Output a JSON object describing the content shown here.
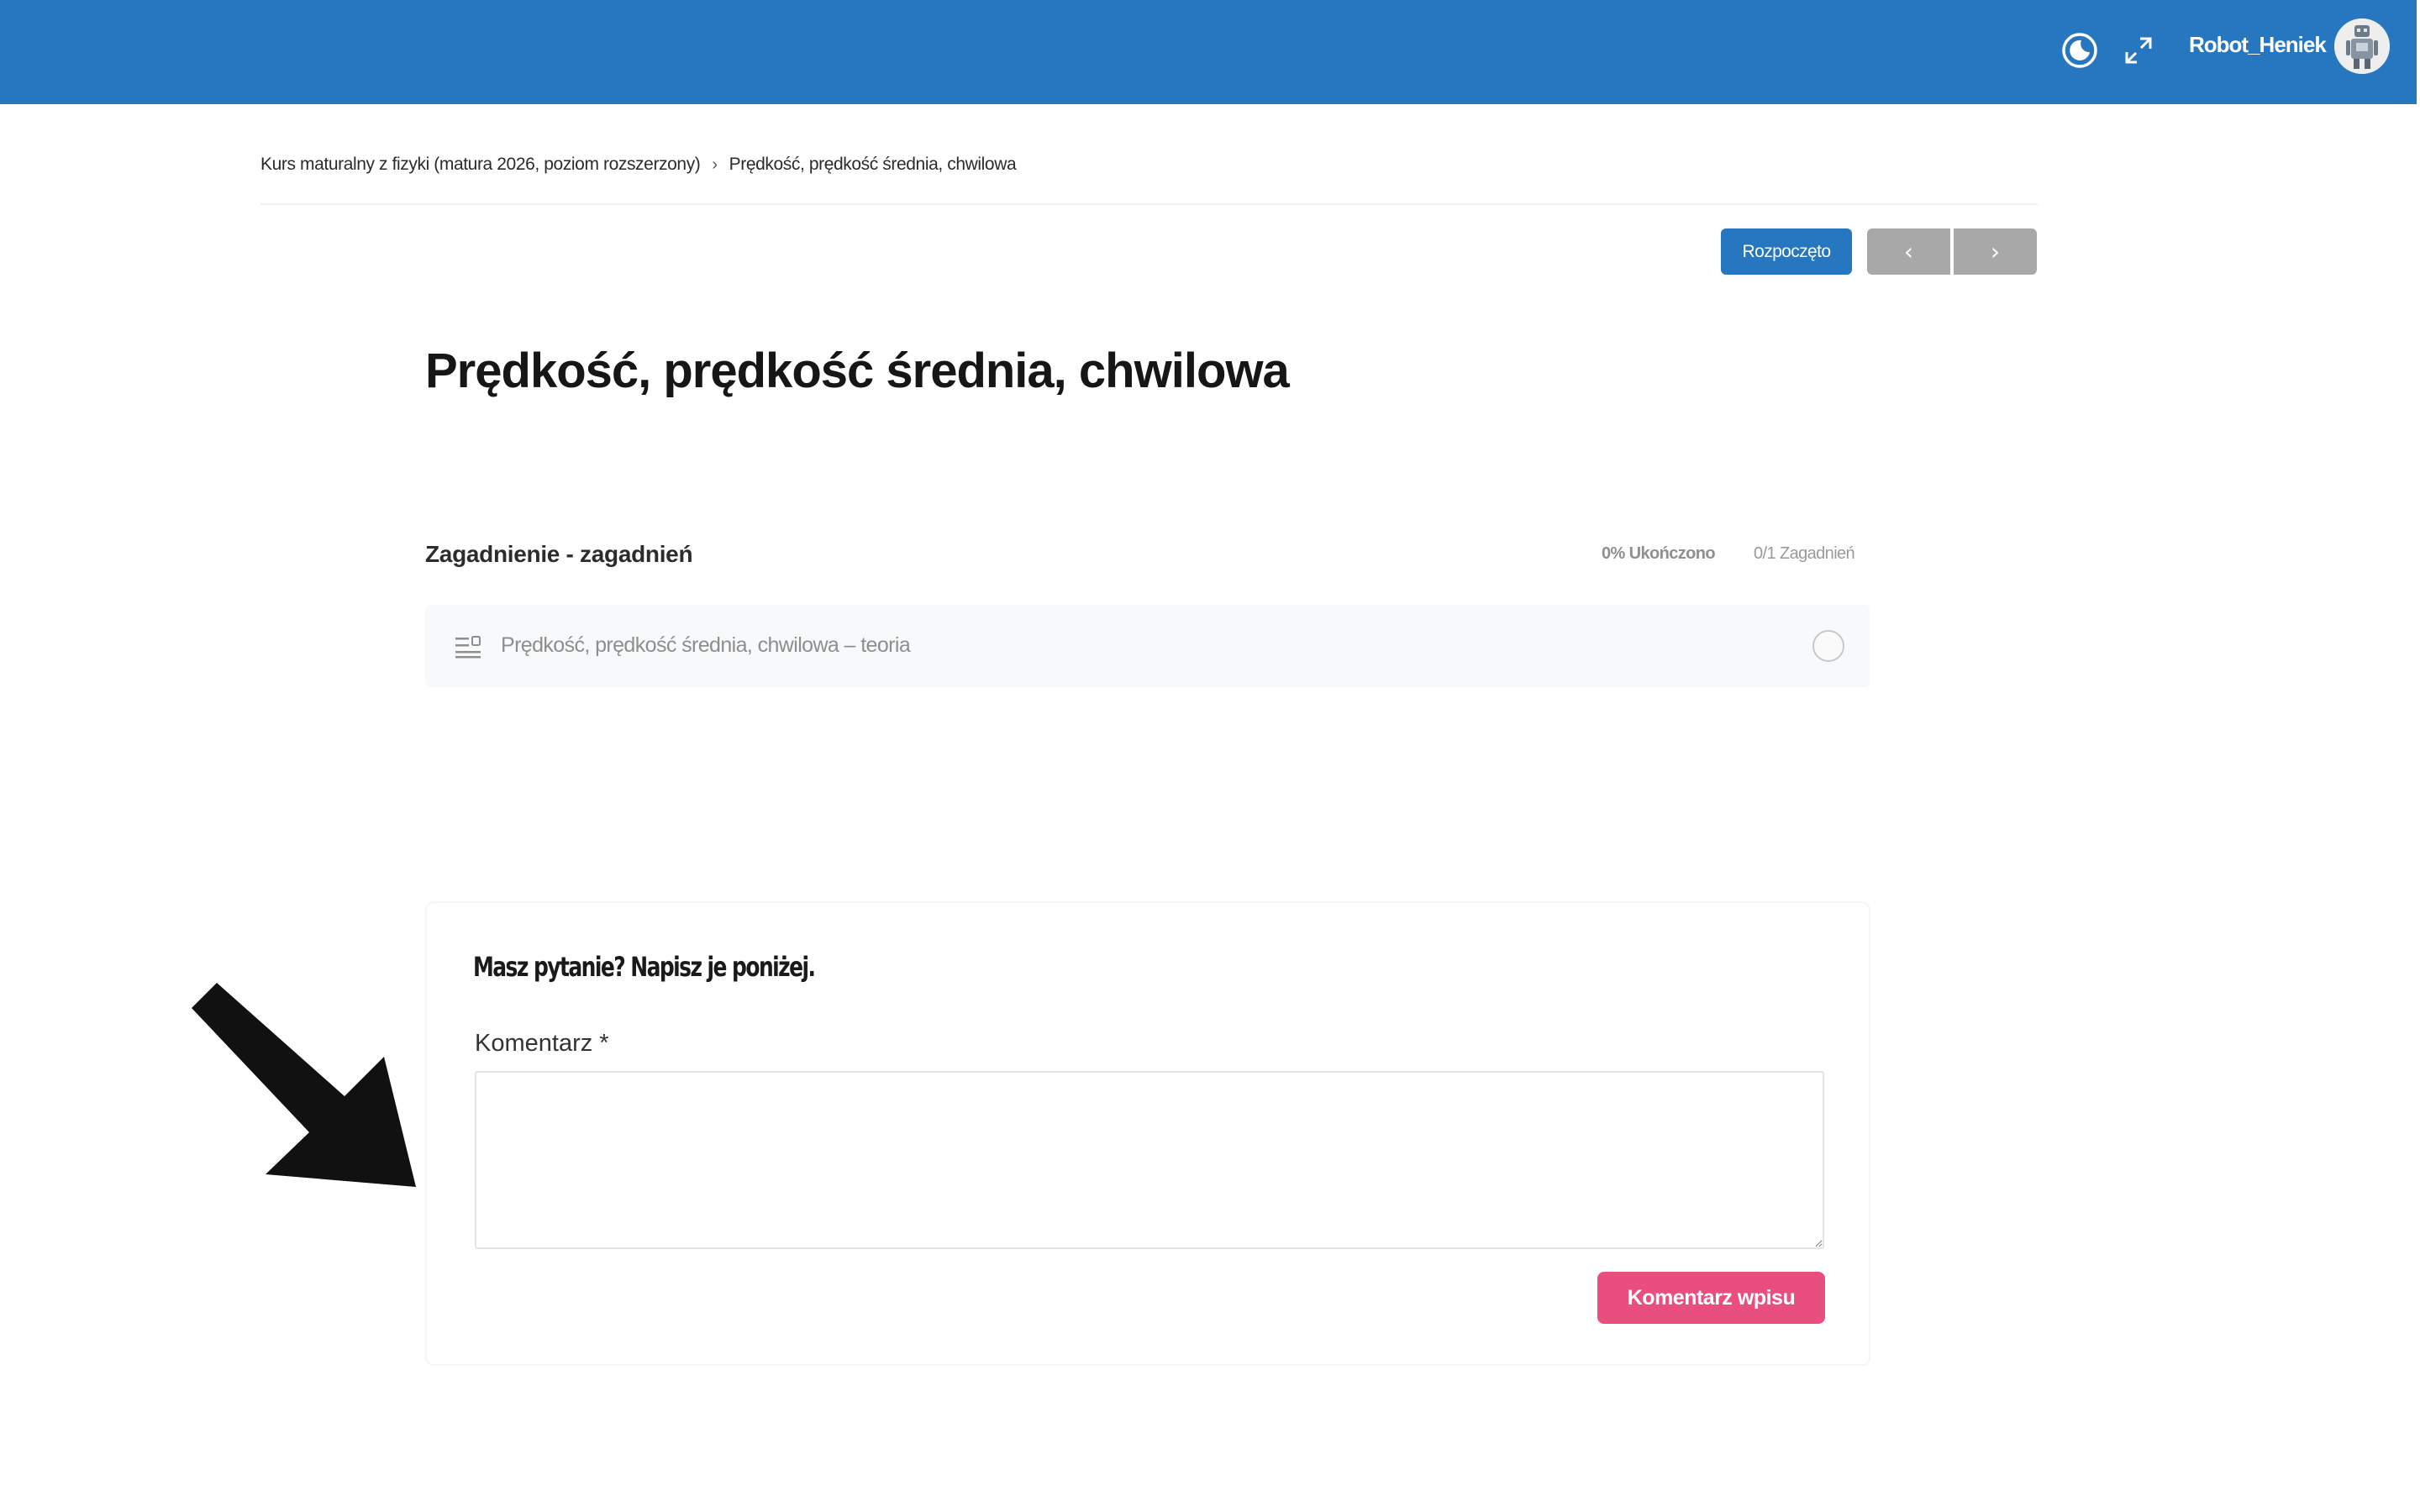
{
  "header": {
    "username": "Robot_Heniek",
    "theme_toggle_icon": "moon-icon",
    "fullscreen_icon": "expand-icon",
    "background_color": "#2776c0"
  },
  "breadcrumb": {
    "items": [
      "Kurs maturalny z fizyki (matura 2026, poziom rozszerzony)",
      "Prędkość, prędkość średnia, chwilowa"
    ],
    "separator": "›"
  },
  "lesson": {
    "status_label": "Rozpoczęto",
    "prev_label": "‹",
    "next_label": "›",
    "title": "Prędkość, prędkość średnia, chwilowa"
  },
  "topics": {
    "heading": "Zagadnienie - zagadnień",
    "progress": "0% Ukończono",
    "count": "0/1 Zagadnień",
    "items": [
      {
        "label": "Prędkość, prędkość średnia, chwilowa – teoria",
        "completed": false
      }
    ]
  },
  "comments": {
    "prompt": "Masz pytanie? Napisz je poniżej.",
    "field_label": "Komentarz *",
    "field_value": "",
    "submit_label": "Komentarz wpisu",
    "submit_color": "#e94f7e"
  }
}
